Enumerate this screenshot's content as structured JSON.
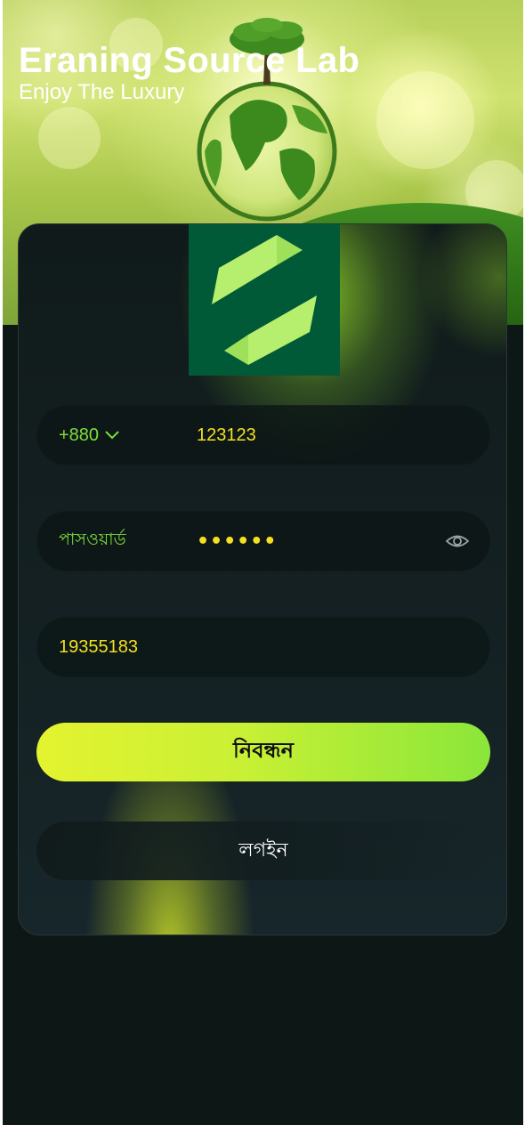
{
  "header": {
    "title": "Eraning Source Lab",
    "subtitle": "Enjoy The Luxury"
  },
  "form": {
    "country_code": "+880",
    "phone_value": "123123",
    "password_label": "পাসওয়ার্ড",
    "password_value": "••••••",
    "invite_code_value": "19355183",
    "register_label": "নিবন্ধন",
    "login_label": "লগইন"
  },
  "icons": {
    "country_dropdown": "chevron-down-icon",
    "password_toggle": "eye-icon",
    "logo": "app-logo"
  },
  "colors": {
    "accent_green": "#7cde3a",
    "value_yellow": "#f5e020",
    "logo_bg": "#005a37",
    "logo_mark": "#b6ee6e",
    "background": "#0d1716"
  }
}
